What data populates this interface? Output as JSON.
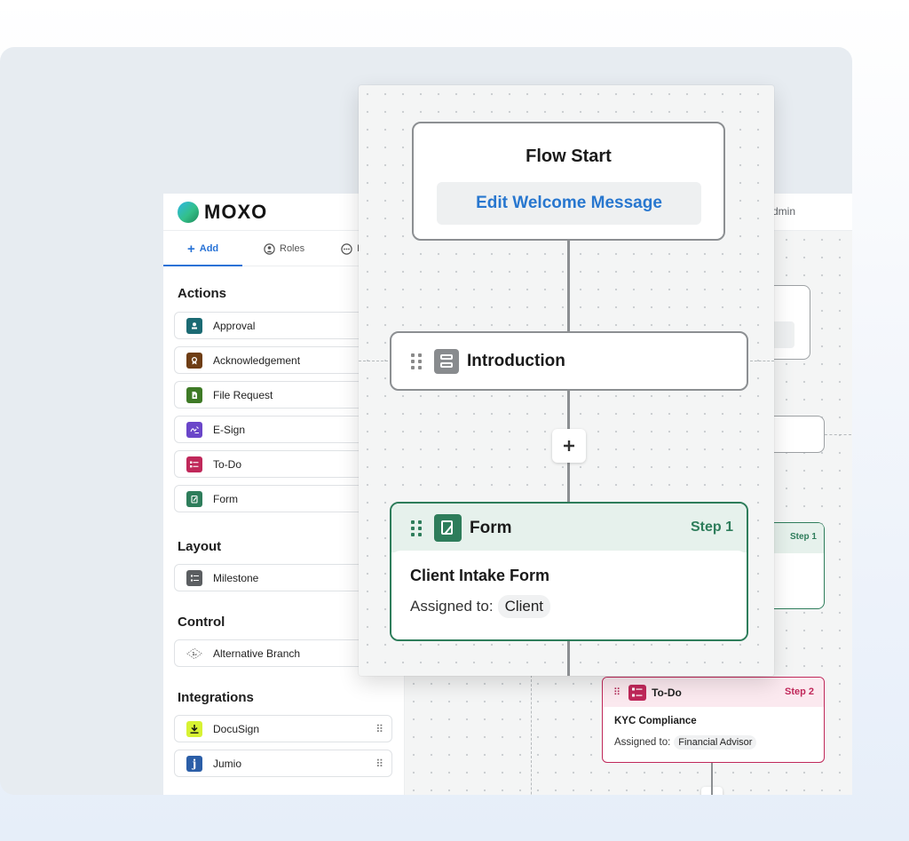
{
  "app": {
    "logo_text": "MOXO",
    "header_right_text": "dmin"
  },
  "tabs": [
    {
      "label": "Add",
      "icon": "plus-icon",
      "active": true
    },
    {
      "label": "Roles",
      "icon": "person-circle-icon",
      "active": false
    },
    {
      "label": "I",
      "icon": "ellipsis-circle-icon",
      "active": false
    }
  ],
  "sidebar": {
    "actions_title": "Actions",
    "actions": [
      {
        "label": "Approval",
        "icon": "approval-icon",
        "color": "#1b6a73"
      },
      {
        "label": "Acknowledgement",
        "icon": "acknowledgement-icon",
        "color": "#6e3d14"
      },
      {
        "label": "File Request",
        "icon": "file-request-icon",
        "color": "#3e7a26"
      },
      {
        "label": "E-Sign",
        "icon": "esign-icon",
        "color": "#6a46c9"
      },
      {
        "label": "To-Do",
        "icon": "todo-icon",
        "color": "#c0285a"
      },
      {
        "label": "Form",
        "icon": "form-icon",
        "color": "#2e7d5b"
      }
    ],
    "layout_title": "Layout",
    "layout": [
      {
        "label": "Milestone",
        "icon": "milestone-icon",
        "color": "#5b5e61"
      }
    ],
    "control_title": "Control",
    "control": [
      {
        "label": "Alternative Branch",
        "icon": "branch-icon",
        "color": "#ffffff"
      }
    ],
    "integrations_title": "Integrations",
    "integrations": [
      {
        "label": "DocuSign",
        "icon": "docusign-icon",
        "color": "#d7f233"
      },
      {
        "label": "Jumio",
        "icon": "jumio-icon",
        "color": "#2b5ea7"
      }
    ]
  },
  "flow": {
    "start_title": "Flow Start",
    "welcome_button": "Edit Welcome Message",
    "intro_label": "Introduction",
    "form_node": {
      "type_label": "Form",
      "step": "Step 1",
      "title": "Client Intake Form",
      "assigned_label": "Assigned to:",
      "assignee": "Client"
    },
    "back_step_label": "Step 1",
    "todo_node": {
      "type_label": "To-Do",
      "step": "Step 2",
      "title": "KYC Compliance",
      "assigned_label": "Assigned to:",
      "assignee": "Financial Advisor"
    }
  },
  "colors": {
    "accent_blue": "#2772d6",
    "form_green": "#2e7d5b",
    "todo_pink": "#c0285a"
  }
}
